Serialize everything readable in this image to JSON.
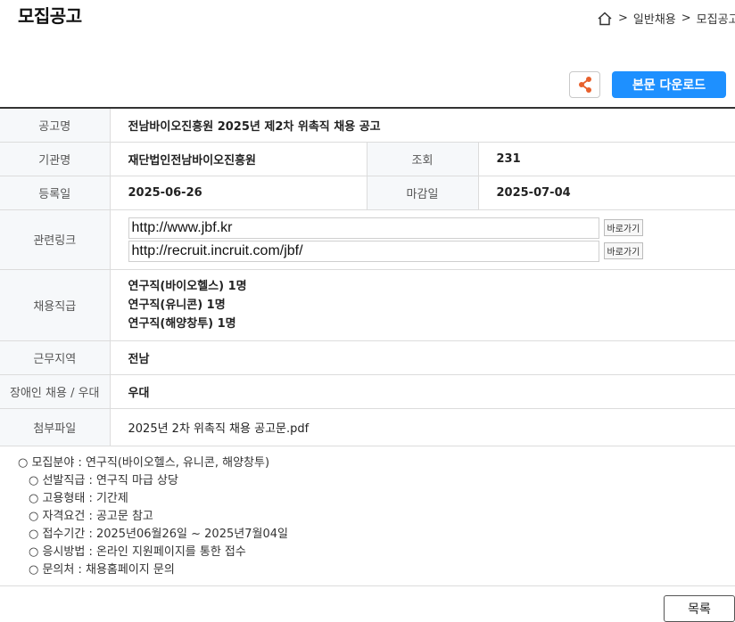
{
  "page": {
    "title": "모집공고"
  },
  "breadcrumb": {
    "items": [
      "일반채용",
      "모집공고"
    ],
    "separator": ">"
  },
  "toolbar": {
    "download_label": "본문 다운로드",
    "share_icon": "share-icon"
  },
  "info": {
    "title_label": "공고명",
    "title_value": "전남바이오진흥원 2025년 제2차 위촉직 채용 공고",
    "org_label": "기관명",
    "org_value": "재단법인전남바이오진흥원",
    "views_label": "조회",
    "views_value": "231",
    "reg_label": "등록일",
    "reg_value": "2025-06-26",
    "deadline_label": "마감일",
    "deadline_value": "2025-07-04",
    "links_label": "관련링크",
    "links": [
      {
        "url": "http://www.jbf.kr",
        "button": "바로가기"
      },
      {
        "url": "http://recruit.incruit.com/jbf/",
        "button": "바로가기"
      }
    ],
    "positions_label": "채용직급",
    "positions": [
      "연구직(바이오헬스) 1명",
      "연구직(유니콘) 1명",
      "연구직(해양창투) 1명"
    ],
    "region_label": "근무지역",
    "region_value": "전남",
    "disabled_label": "장애인 채용 / 우대",
    "disabled_value": "우대",
    "attachment_label": "첨부파일",
    "attachment_value": "2025년 2차 위촉직 채용 공고문.pdf"
  },
  "description": [
    "○ 모집분야 : 연구직(바이오헬스, 유니콘, 해양창투)",
    "○ 선발직급 : 연구직 마급 상당",
    "○ 고용형태 : 기간제",
    "○ 자격요건 : 공고문 참고",
    "○ 접수기간 : 2025년06월26일 ~ 2025년7월04일",
    "○ 응시방법 : 온라인 지원페이지를 통한 접수",
    "○ 문의처 : 채용홈페이지 문의"
  ],
  "footer": {
    "list_label": "목록"
  },
  "colors": {
    "accent": "#1e90ff",
    "share_icon": "#e8602c"
  }
}
